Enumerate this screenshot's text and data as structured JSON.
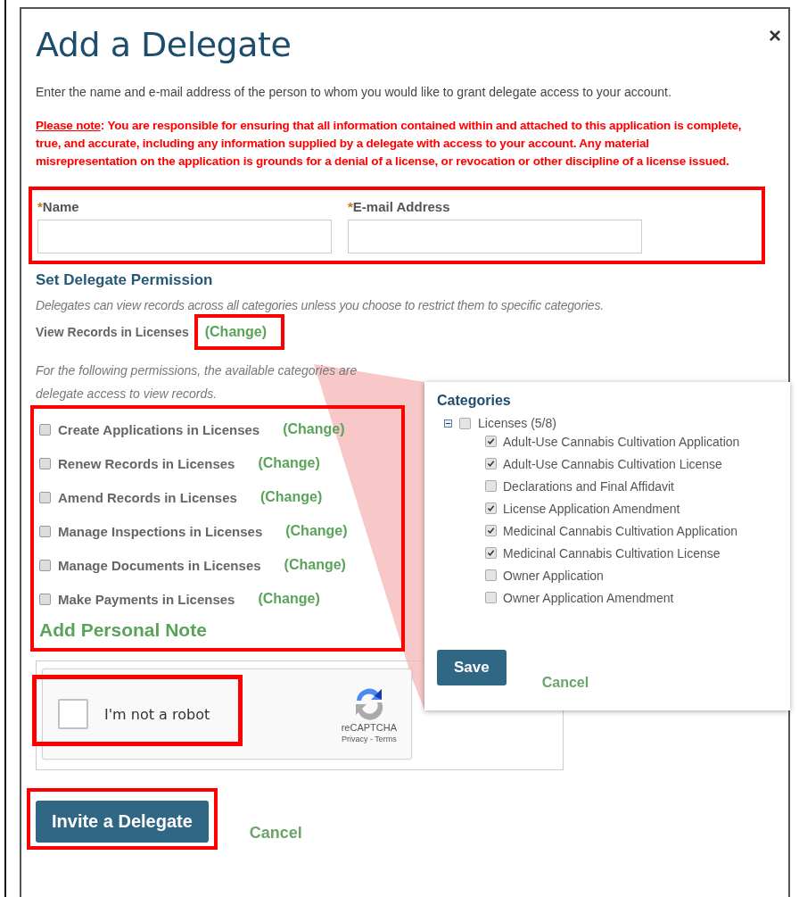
{
  "dialog": {
    "title": "Add a Delegate",
    "close": "×",
    "intro": "Enter the name and e-mail address of the person to whom you would like to grant delegate access to your account.",
    "note_label": "Please note",
    "note": ": You are responsible for ensuring that all information contained within and attached to this application is complete, true, and accurate, including any information supplied by a delegate with access to your account.  Any material misrepresentation on the application is grounds for a denial of a license, or revocation or other discipline of a license issued."
  },
  "fields": {
    "highlighted": true,
    "items": [
      {
        "label": "Name",
        "required_mark": "*"
      },
      {
        "label": "E-mail Address",
        "required_mark": "*"
      }
    ]
  },
  "permissions": {
    "heading": "Set Delegate Permission",
    "hint": "Delegates can view records across all categories unless you choose to restrict them to specific categories.",
    "view": {
      "label": "View Records in Licenses",
      "link": "(Change)",
      "highlighted": true
    },
    "hint2_lines": [
      "For the following permissions, the available categories are",
      "delegate access to view records."
    ],
    "highlighted": true,
    "items": [
      {
        "label": "Create Applications in Licenses",
        "checked": false,
        "link": "(Change)"
      },
      {
        "label": "Renew Records in Licenses",
        "checked": false,
        "link": "(Change)"
      },
      {
        "label": "Amend Records in Licenses",
        "checked": false,
        "link": "(Change)"
      },
      {
        "label": "Manage Inspections in Licenses",
        "checked": false,
        "link": "(Change)"
      },
      {
        "label": "Manage Documents in Licenses",
        "checked": false,
        "link": "(Change)"
      },
      {
        "label": "Make Payments in Licenses",
        "checked": false,
        "link": "(Change)"
      }
    ],
    "note_link": "Add Personal Note"
  },
  "captcha": {
    "label": "I'm not a robot",
    "checked": false,
    "highlighted": true,
    "brand": "reCAPTCHA",
    "links": "Privacy - Terms"
  },
  "actions": {
    "primary": "Invite a Delegate",
    "primary_highlighted": true,
    "cancel": "Cancel"
  },
  "popup": {
    "title": "Categories",
    "group": {
      "label": "Licenses (5/8)",
      "expanded": true,
      "checked": false,
      "children": [
        {
          "label": "Adult-Use Cannabis Cultivation Application",
          "checked": true
        },
        {
          "label": "Adult-Use Cannabis Cultivation License",
          "checked": true
        },
        {
          "label": "Declarations and Final Affidavit",
          "checked": false
        },
        {
          "label": "License Application Amendment",
          "checked": true
        },
        {
          "label": "Medicinal Cannabis Cultivation Application",
          "checked": true
        },
        {
          "label": "Medicinal Cannabis Cultivation License",
          "checked": true
        },
        {
          "label": "Owner Application",
          "checked": false
        },
        {
          "label": "Owner Application Amendment",
          "checked": false
        }
      ]
    },
    "save": "Save",
    "cancel": "Cancel"
  }
}
